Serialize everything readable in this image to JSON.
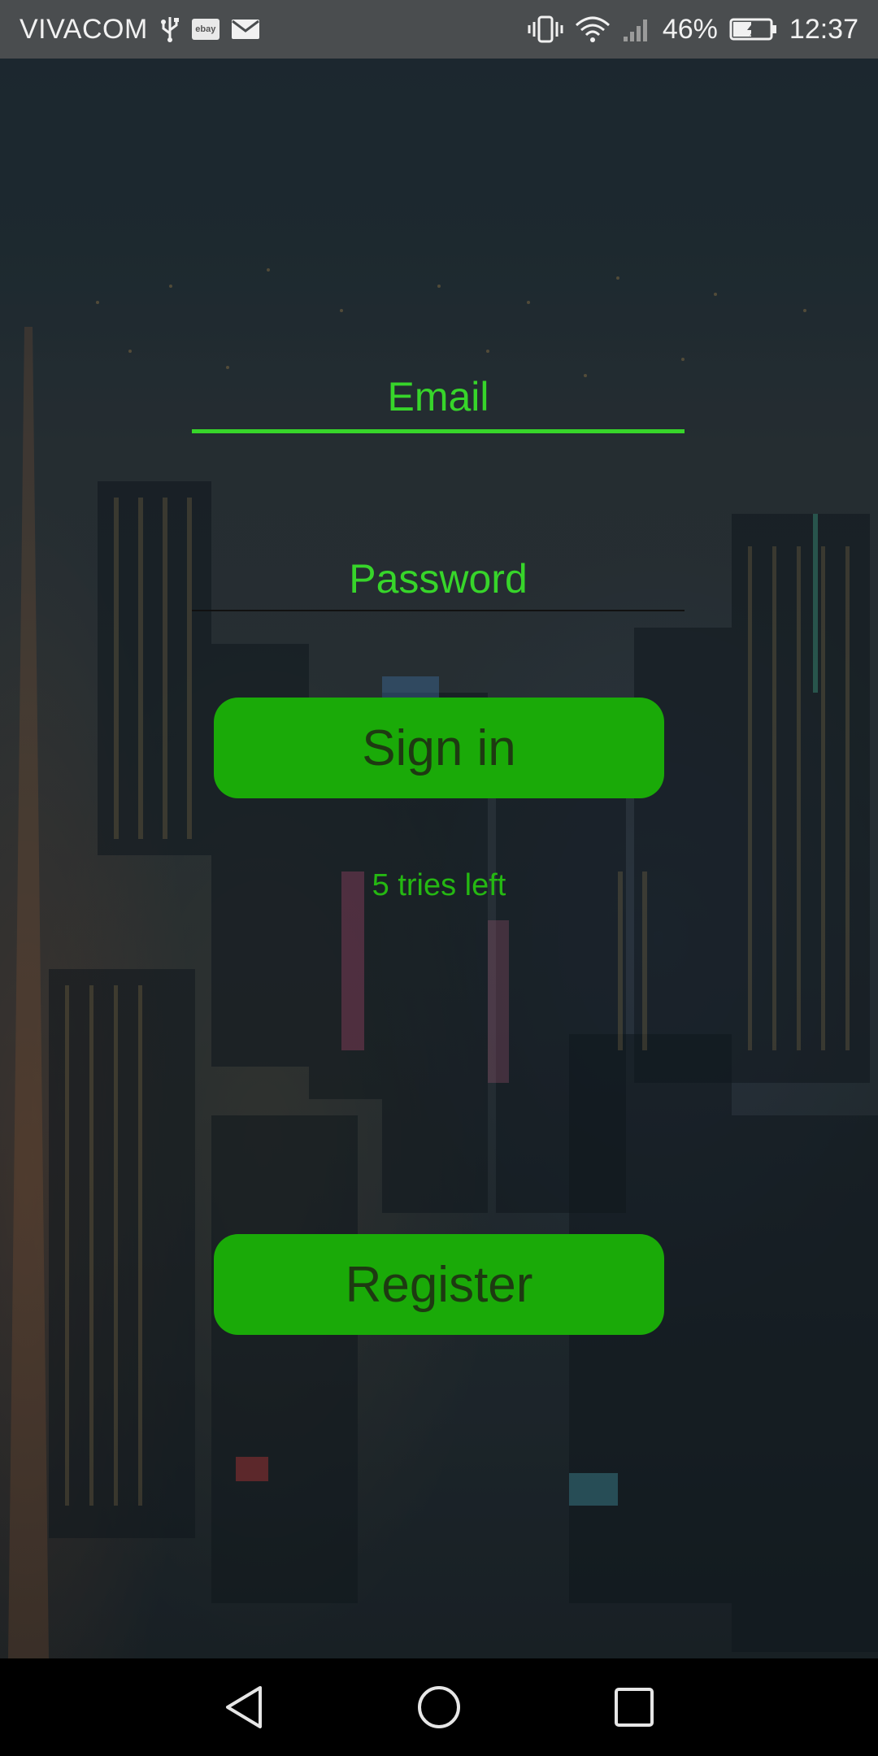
{
  "status_bar": {
    "carrier": "VIVACOM",
    "battery_percent": "46%",
    "time": "12:37",
    "icons": [
      "usb-icon",
      "ebay-icon",
      "mail-icon",
      "vibrate-icon",
      "wifi-icon",
      "signal-icon",
      "battery-icon"
    ]
  },
  "form": {
    "email_placeholder": "Email",
    "password_placeholder": "Password",
    "signin_label": "Sign in",
    "tries_text": "5 tries left",
    "register_label": "Register"
  },
  "colors": {
    "accent": "#37d52a",
    "button": "#1aaa08",
    "button_text": "#1e3a12",
    "status_bar": "#4a4d4f",
    "nav_bar": "#000000"
  },
  "nav_bar": {
    "icons": [
      "back-icon",
      "home-icon",
      "recents-icon"
    ]
  }
}
